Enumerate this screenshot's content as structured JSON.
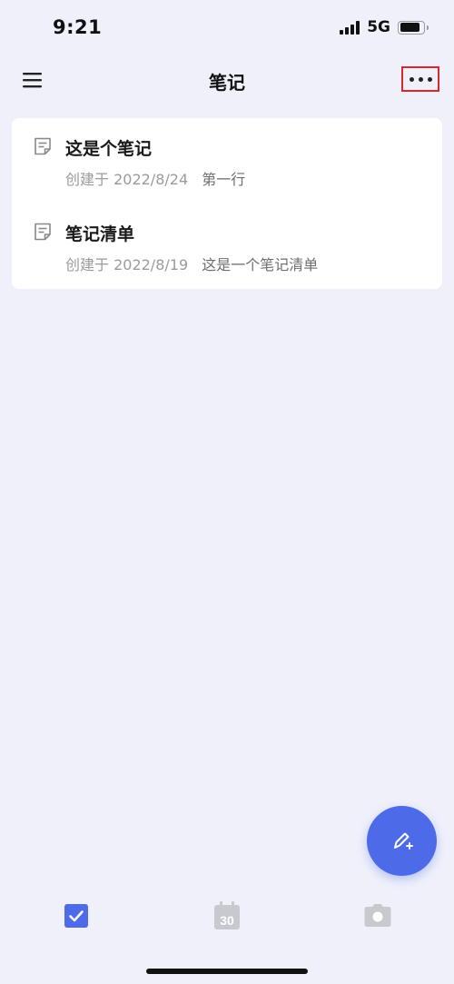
{
  "status_bar": {
    "time": "9:21",
    "network": "5G",
    "battery_level": 0.85
  },
  "nav": {
    "title": "笔记",
    "menu_icon": "hamburger-menu-icon",
    "more_icon": "more-dots-icon"
  },
  "notes": [
    {
      "title": "这是个笔记",
      "date": "创建于 2022/8/24",
      "preview": "第一行",
      "icon": "note-icon"
    },
    {
      "title": "笔记清单",
      "date": "创建于 2022/8/19",
      "preview": "这是一个笔记清单",
      "icon": "note-icon"
    }
  ],
  "fab": {
    "icon": "pen-plus-icon"
  },
  "tabs": [
    {
      "icon": "checkbox-icon",
      "active": true
    },
    {
      "icon": "calendar-icon",
      "label": "30",
      "active": false
    },
    {
      "icon": "camera-icon",
      "active": false
    }
  ],
  "colors": {
    "background": "#eff0fa",
    "accent": "#4d6ae8",
    "highlight_border": "#d9262c",
    "inactive_icon": "#c8c9cf"
  }
}
